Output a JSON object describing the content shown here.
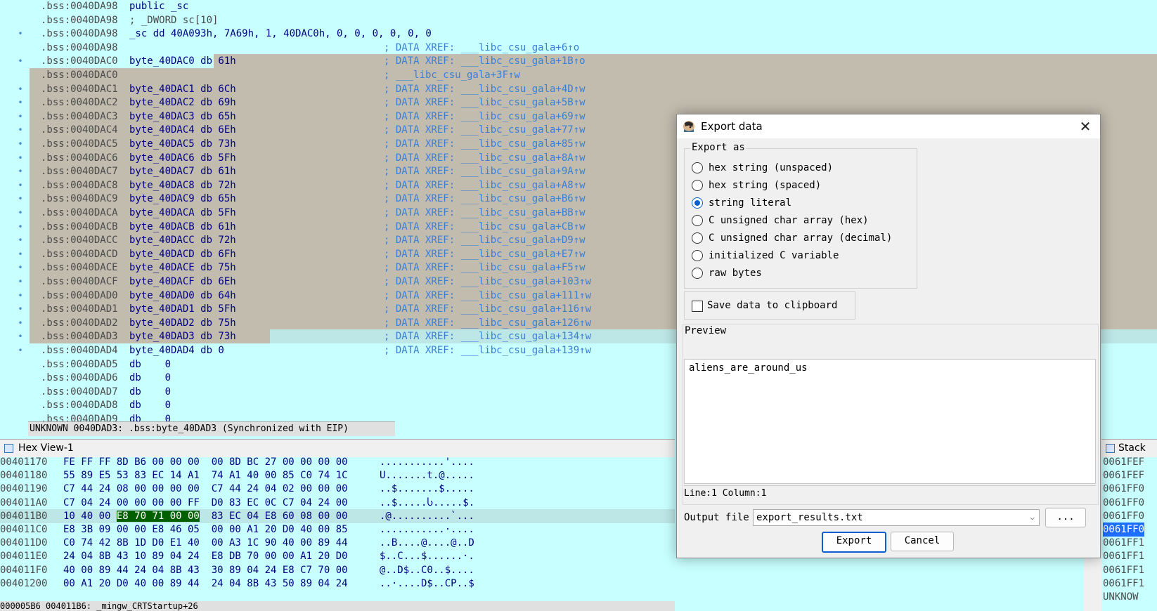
{
  "disasm": {
    "lines": [
      {
        "addr": ".bss:0040DA98",
        "code": "public _sc",
        "cmt": ""
      },
      {
        "addr": ".bss:0040DA98",
        "code": "; _DWORD sc[10]",
        "cmt": ""
      },
      {
        "addr": ".bss:0040DA98",
        "code": "_sc dd 40A093h, 7A69h, 1, 40DAC0h, 0, 0, 0, 0, 0, 0",
        "cmt": ""
      },
      {
        "addr": ".bss:0040DA98",
        "code": "",
        "cmt": "; DATA XREF: ___libc_csu_gala+6↑o"
      },
      {
        "addr": ".bss:0040DAC0",
        "code": "byte_40DAC0 db 61h",
        "cmt": "; DATA XREF: ___libc_csu_gala+1B↑o"
      },
      {
        "addr": ".bss:0040DAC0",
        "code": "",
        "cmt": "; ___libc_csu_gala+3F↑w"
      },
      {
        "addr": ".bss:0040DAC1",
        "code": "byte_40DAC1 db 6Ch",
        "cmt": "; DATA XREF: ___libc_csu_gala+4D↑w"
      },
      {
        "addr": ".bss:0040DAC2",
        "code": "byte_40DAC2 db 69h",
        "cmt": "; DATA XREF: ___libc_csu_gala+5B↑w"
      },
      {
        "addr": ".bss:0040DAC3",
        "code": "byte_40DAC3 db 65h",
        "cmt": "; DATA XREF: ___libc_csu_gala+69↑w"
      },
      {
        "addr": ".bss:0040DAC4",
        "code": "byte_40DAC4 db 6Eh",
        "cmt": "; DATA XREF: ___libc_csu_gala+77↑w"
      },
      {
        "addr": ".bss:0040DAC5",
        "code": "byte_40DAC5 db 73h",
        "cmt": "; DATA XREF: ___libc_csu_gala+85↑w"
      },
      {
        "addr": ".bss:0040DAC6",
        "code": "byte_40DAC6 db 5Fh",
        "cmt": "; DATA XREF: ___libc_csu_gala+8A↑w"
      },
      {
        "addr": ".bss:0040DAC7",
        "code": "byte_40DAC7 db 61h",
        "cmt": "; DATA XREF: ___libc_csu_gala+9A↑w"
      },
      {
        "addr": ".bss:0040DAC8",
        "code": "byte_40DAC8 db 72h",
        "cmt": "; DATA XREF: ___libc_csu_gala+A8↑w"
      },
      {
        "addr": ".bss:0040DAC9",
        "code": "byte_40DAC9 db 65h",
        "cmt": "; DATA XREF: ___libc_csu_gala+B6↑w"
      },
      {
        "addr": ".bss:0040DACA",
        "code": "byte_40DACA db 5Fh",
        "cmt": "; DATA XREF: ___libc_csu_gala+BB↑w"
      },
      {
        "addr": ".bss:0040DACB",
        "code": "byte_40DACB db 61h",
        "cmt": "; DATA XREF: ___libc_csu_gala+CB↑w"
      },
      {
        "addr": ".bss:0040DACC",
        "code": "byte_40DACC db 72h",
        "cmt": "; DATA XREF: ___libc_csu_gala+D9↑w"
      },
      {
        "addr": ".bss:0040DACD",
        "code": "byte_40DACD db 6Fh",
        "cmt": "; DATA XREF: ___libc_csu_gala+E7↑w"
      },
      {
        "addr": ".bss:0040DACE",
        "code": "byte_40DACE db 75h",
        "cmt": "; DATA XREF: ___libc_csu_gala+F5↑w"
      },
      {
        "addr": ".bss:0040DACF",
        "code": "byte_40DACF db 6Eh",
        "cmt": "; DATA XREF: ___libc_csu_gala+103↑w"
      },
      {
        "addr": ".bss:0040DAD0",
        "code": "byte_40DAD0 db 64h",
        "cmt": "; DATA XREF: ___libc_csu_gala+111↑w"
      },
      {
        "addr": ".bss:0040DAD1",
        "code": "byte_40DAD1 db 5Fh",
        "cmt": "; DATA XREF: ___libc_csu_gala+116↑w"
      },
      {
        "addr": ".bss:0040DAD2",
        "code": "byte_40DAD2 db 75h",
        "cmt": "; DATA XREF: ___libc_csu_gala+126↑w"
      },
      {
        "addr": ".bss:0040DAD3",
        "code": "byte_40DAD3 db 73h",
        "cmt": "; DATA XREF: ___libc_csu_gala+134↑w"
      },
      {
        "addr": ".bss:0040DAD4",
        "code": "byte_40DAD4 db 0",
        "cmt": "; DATA XREF: ___libc_csu_gala+139↑w"
      },
      {
        "addr": ".bss:0040DAD5",
        "code": "db    0",
        "cmt": ""
      },
      {
        "addr": ".bss:0040DAD6",
        "code": "db    0",
        "cmt": ""
      },
      {
        "addr": ".bss:0040DAD7",
        "code": "db    0",
        "cmt": ""
      },
      {
        "addr": ".bss:0040DAD8",
        "code": "db    0",
        "cmt": ""
      },
      {
        "addr": ".bss:0040DAD9",
        "code": "db    0",
        "cmt": ""
      }
    ],
    "status": "UNKNOWN 0040DAD3: .bss:byte_40DAD3 (Synchronized with EIP)"
  },
  "hex_view": {
    "title": "Hex View-1",
    "rows": [
      {
        "addr": "00401170",
        "bytes": "FE FF FF 8D B6 00 00 00  00 8D BC 27 00 00 00 00",
        "ascii": "...........'...."
      },
      {
        "addr": "00401180",
        "bytes": "55 89 E5 53 83 EC 14 A1  74 A1 40 00 85 C0 74 1C",
        "ascii": "U.......t.@....."
      },
      {
        "addr": "00401190",
        "bytes": "C7 44 24 08 00 00 00 00  C7 44 24 04 02 00 00 00",
        "ascii": "..$.......$....."
      },
      {
        "addr": "004011A0",
        "bytes": "C7 04 24 00 00 00 00 FF  D0 83 EC 0C C7 04 24 00",
        "ascii": "..$.....Ⴑ.....$."
      },
      {
        "addr": "004011B0",
        "bytes_pre": "10 40 00 ",
        "bytes_hl": "E8 70 71 00 00",
        "bytes_post": "  83 EC 04 E8 60 08 00 00",
        "ascii": ".@..........`..."
      },
      {
        "addr": "004011C0",
        "bytes": "E8 3B 09 00 00 E8 46 05  00 00 A1 20 D0 40 00 85",
        "ascii": "...........·...."
      },
      {
        "addr": "004011D0",
        "bytes": "C0 74 42 8B 1D D0 E1 40  00 A3 1C 90 40 00 89 44",
        "ascii": "..B....@....@..D"
      },
      {
        "addr": "004011E0",
        "bytes": "24 04 8B 43 10 89 04 24  E8 DB 70 00 00 A1 20 D0",
        "ascii": "$..C...$......·."
      },
      {
        "addr": "004011F0",
        "bytes": "40 00 89 44 24 04 8B 43  30 89 04 24 E8 C7 70 00",
        "ascii": "@..D$..C0..$...."
      },
      {
        "addr": "00401200",
        "bytes": "00 A1 20 D0 40 00 89 44  24 04 8B 43 50 89 04 24",
        "ascii": "..·....D$..CP..$"
      }
    ],
    "status": "000005B6 004011B6: _mingw_CRTStartup+26"
  },
  "stack_view": {
    "title": "Stack",
    "rows": [
      "0061FEF",
      "0061FEF",
      "0061FF0",
      "0061FF0",
      "0061FF0",
      "0061FF0",
      "0061FF1",
      "0061FF1",
      "0061FF1",
      "0061FF1",
      "UNKNOW"
    ],
    "selected_index": 5
  },
  "dialog": {
    "title": "Export data",
    "export_as_label": "Export as",
    "options": [
      {
        "label": "hex string (unspaced)",
        "checked": false
      },
      {
        "label": "hex string (spaced)",
        "checked": false
      },
      {
        "label": "string literal",
        "checked": true
      },
      {
        "label": "C unsigned char array (hex)",
        "checked": false
      },
      {
        "label": "C unsigned char array (decimal)",
        "checked": false
      },
      {
        "label": "initialized C variable",
        "checked": false
      },
      {
        "label": "raw bytes",
        "checked": false
      }
    ],
    "clipboard_label": "Save data to clipboard",
    "clipboard_checked": false,
    "preview_label": "Preview",
    "preview_text": "aliens_are_around_us",
    "line_col": "Line:1  Column:1",
    "output_label": "Output file",
    "output_value": "export_results.txt",
    "browse_label": "...",
    "export_label": "Export",
    "cancel_label": "Cancel",
    "accent": "#0a5fd0"
  }
}
